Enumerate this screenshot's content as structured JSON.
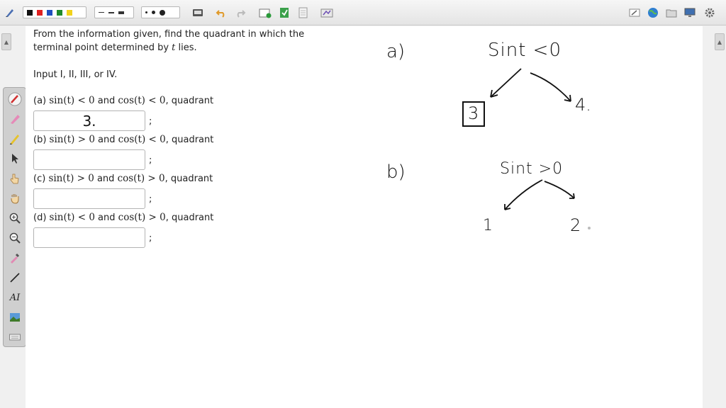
{
  "problem": {
    "intro_line1": "From the information given, find the quadrant in which the",
    "intro_line2_pre": "terminal point determined by ",
    "intro_line2_var": "t",
    "intro_line2_post": " lies.",
    "instruction": "Input I, II, III, or IV.",
    "items": [
      {
        "label": "(a) ",
        "math1": "sin(t) < 0",
        "and": " and ",
        "math2": "cos(t) < 0",
        "suffix": ", quadrant",
        "answer": "3.",
        "semicolon": ";"
      },
      {
        "label": "(b) ",
        "math1": "sin(t) > 0",
        "and": " and ",
        "math2": "cos(t) < 0",
        "suffix": ", quadrant",
        "answer": "",
        "semicolon": ";"
      },
      {
        "label": "(c) ",
        "math1": "sin(t) > 0",
        "and": " and ",
        "math2": "cos(t) > 0",
        "suffix": ", quadrant",
        "answer": "",
        "semicolon": ";"
      },
      {
        "label": "(d) ",
        "math1": "sin(t) < 0",
        "and": " and ",
        "math2": "cos(t) > 0",
        "suffix": ", quadrant",
        "answer": "",
        "semicolon": ";"
      }
    ]
  },
  "handwriting": {
    "a_label": "a)",
    "a_expr": "Sint <0",
    "a_left": "3",
    "a_right": "4.",
    "b_label": "b)",
    "b_expr": "Sint >0",
    "b_left": "1",
    "b_right": "2"
  },
  "colors": {
    "swatch_black": "#111111",
    "swatch_red": "#e02020",
    "swatch_blue": "#1f4fbf",
    "swatch_green": "#1f8a2a",
    "swatch_yellow": "#f2d21b"
  },
  "toolbar_icons": [
    "pen-icon",
    "undo-icon",
    "redo-icon",
    "new-page-icon",
    "insert-page-icon",
    "document-icon",
    "screen-capture-icon",
    "edit-icon",
    "globe-icon",
    "folder-icon",
    "display-icon",
    "settings-icon"
  ],
  "palette_tools": [
    "pen-tool-icon",
    "highlighter-icon",
    "marker-icon",
    "select-arrow-icon",
    "hand-pointer-icon",
    "hand-pan-icon",
    "zoom-in-icon",
    "zoom-out-icon",
    "eyedropper-icon",
    "line-icon",
    "text-icon",
    "image-icon",
    "keyboard-icon"
  ]
}
